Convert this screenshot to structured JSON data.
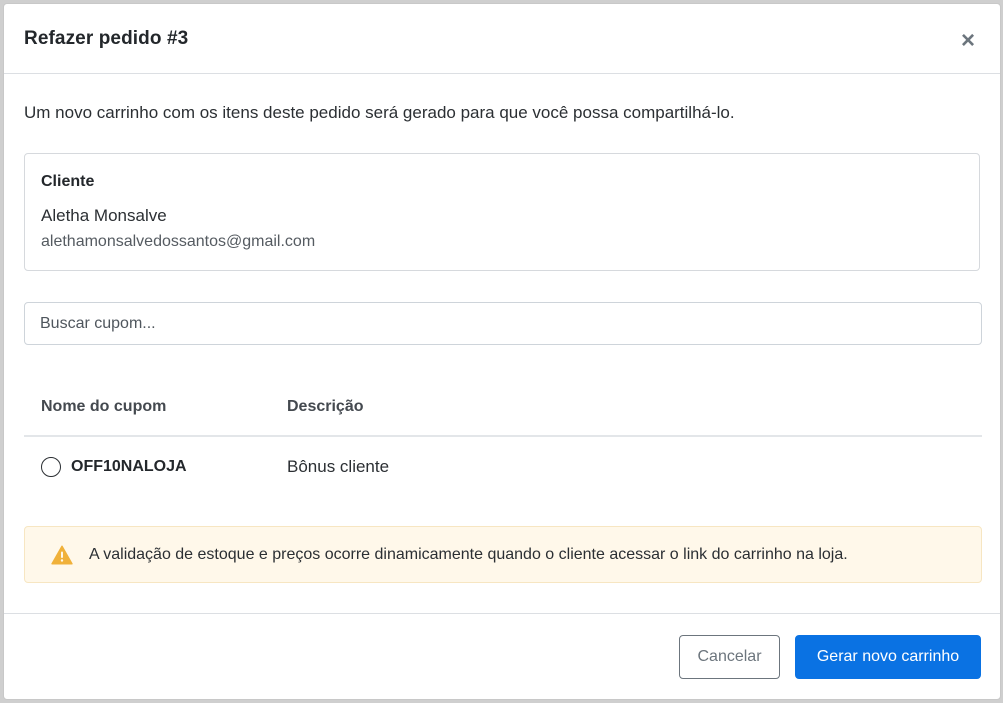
{
  "modal": {
    "title": "Refazer pedido #3",
    "close_symbol": "×",
    "intro": "Um novo carrinho com os itens deste pedido será gerado para que você possa compartilhá-lo."
  },
  "client": {
    "heading": "Cliente",
    "name": "Aletha Monsalve",
    "email": "alethamonsalvedossantos@gmail.com"
  },
  "search": {
    "placeholder": "Buscar cupom...",
    "value": ""
  },
  "table": {
    "headers": [
      "Nome do cupom",
      "Descrição"
    ],
    "rows": [
      {
        "code": "OFF10NALOJA",
        "description": "Bônus cliente",
        "selected": false
      }
    ]
  },
  "alert": {
    "icon": "warning-triangle-icon",
    "icon_color": "#f0b13a",
    "text": "A validação de estoque e preços ocorre dinamicamente quando o cliente acessar o link do carrinho na loja."
  },
  "footer": {
    "cancel_label": "Cancelar",
    "submit_label": "Gerar novo carrinho"
  },
  "colors": {
    "primary": "#0a72e3",
    "alert_bg": "#fff8ea"
  }
}
